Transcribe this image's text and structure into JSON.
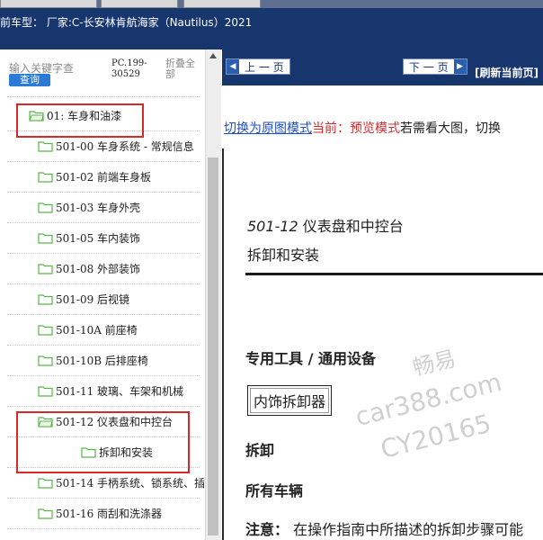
{
  "header": {
    "vehicle_text": "前车型： 厂家:C-长安林肯航海家（Nautilus）2021"
  },
  "left_panel": {
    "search_label": "输入关键字查",
    "query_button": "查询",
    "pc_code": "PC.199-30529",
    "collapse_all": "折叠全部",
    "tree_items": [
      {
        "label": "01: 车身和油漆",
        "level": 1
      },
      {
        "label": "501-00 车身系统 - 常规信息",
        "level": 2
      },
      {
        "label": "501-02 前端车身板",
        "level": 2
      },
      {
        "label": "501-03 车身外壳",
        "level": 2
      },
      {
        "label": "501-05 车内装饰",
        "level": 2
      },
      {
        "label": "501-08 外部装饰",
        "level": 2
      },
      {
        "label": "501-09 后视镜",
        "level": 2
      },
      {
        "label": "501-10A 前座椅",
        "level": 2
      },
      {
        "label": "501-10B 后排座椅",
        "level": 2
      },
      {
        "label": "501-11 玻璃、车架和机械",
        "level": 2
      },
      {
        "label": "501-12 仪表盘和中控台",
        "level": 2
      },
      {
        "label": "拆卸和安装",
        "level": 3
      },
      {
        "label": "501-14 手柄系统、锁系统、插",
        "level": 2
      },
      {
        "label": "501-16 雨刮和洗涤器",
        "level": 2
      }
    ]
  },
  "nav": {
    "prev_label": "上 一 页",
    "next_label": "下 一 页",
    "refresh_label": "[刷新当前页]"
  },
  "mode": {
    "switch_link": "切换为原图模式",
    "current": "当前：预览模式",
    "rest": "若需看大图，切换"
  },
  "document": {
    "title_number": "501-12",
    "title_rest": " 仪表盘和中控台",
    "subtitle": "拆卸和安装",
    "tools_heading": "专用工具 / 通用设备",
    "tool_item": "内饰拆卸器",
    "section_removal": "拆卸",
    "section_all_vehicles": "所有车辆",
    "note_label": "注意：",
    "note_text": " 在操作指南中所描述的拆卸步骤可能"
  },
  "watermark": {
    "line1": "畅易",
    "line2": "car388.com",
    "line3": "CY20165"
  },
  "colors": {
    "header_bg": "#17366d",
    "link_blue": "#1f4fd1",
    "highlight_red": "#d62a2a",
    "folder_green": "#5ab44a"
  }
}
